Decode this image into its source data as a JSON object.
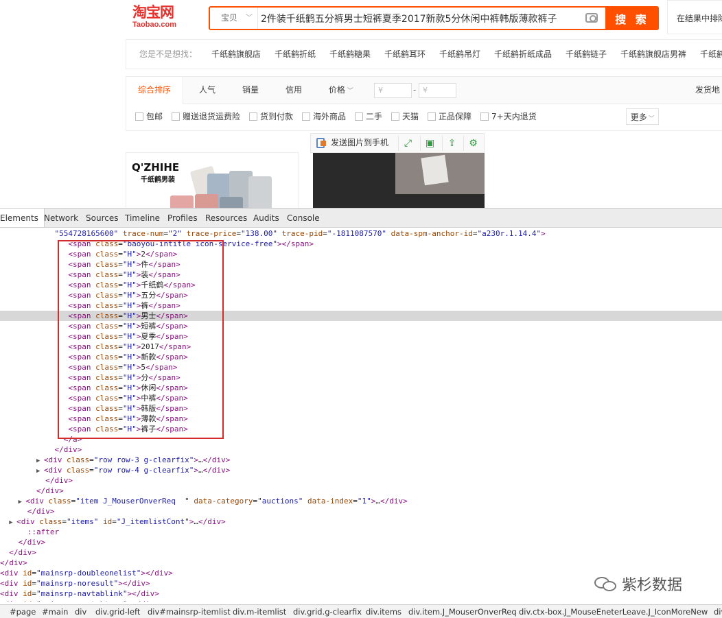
{
  "taobao": {
    "logo_cn": "淘宝网",
    "logo_en": "Taobao.com",
    "search_category": "宝贝",
    "search_value": "2件装千纸鹤五分裤男士短裤夏季2017新款5分休闲中裤韩版薄款裤子",
    "search_button": "搜 索",
    "search_in_results": "在结果中排除",
    "suggest_label": "您是不是想找：",
    "suggestions": [
      "千纸鹤旗舰店",
      "千纸鹤折纸",
      "千纸鹤糖果",
      "千纸鹤耳环",
      "千纸鹤吊灯",
      "千纸鹤折纸成品",
      "千纸鹤链子",
      "千纸鹤旗舰店男裤",
      "千纸鹤"
    ],
    "sort_tabs": [
      "综合排序",
      "人气",
      "销量",
      "信用",
      "价格"
    ],
    "price_from_placeholder": "¥",
    "price_to_placeholder": "¥",
    "price_dash": "-",
    "ship_from": "发货地",
    "filters": [
      "包邮",
      "赠送退货运费险",
      "货到付款",
      "海外商品",
      "二手",
      "天猫",
      "正品保障",
      "7+天内退货"
    ],
    "more": "更多",
    "send_to_phone": "发送图片到手机",
    "brand_name": "Q'ZHIHE",
    "brand_sub": "千纸鹤男装"
  },
  "devtools": {
    "tabs": [
      "Elements",
      "Network",
      "Sources",
      "Timeline",
      "Profiles",
      "Resources",
      "Audits",
      "Console"
    ],
    "top_line": {
      "indent": "            ",
      "parts": [
        {
          "t": "val",
          "s": "\"554728165600\""
        },
        {
          "t": "txt",
          "s": " "
        },
        {
          "t": "attr",
          "s": "trace-num"
        },
        {
          "t": "txt",
          "s": "="
        },
        {
          "t": "val",
          "s": "\"2\""
        },
        {
          "t": "txt",
          "s": " "
        },
        {
          "t": "attr",
          "s": "trace-price"
        },
        {
          "t": "txt",
          "s": "="
        },
        {
          "t": "val",
          "s": "\"138.00\""
        },
        {
          "t": "txt",
          "s": " "
        },
        {
          "t": "attr",
          "s": "trace-pid"
        },
        {
          "t": "txt",
          "s": "="
        },
        {
          "t": "val",
          "s": "\"-1811087570\""
        },
        {
          "t": "txt",
          "s": " "
        },
        {
          "t": "attr",
          "s": "data-spm-anchor-id"
        },
        {
          "t": "txt",
          "s": "="
        },
        {
          "t": "val",
          "s": "\"a230r.1.14.4\""
        },
        {
          "t": "tag",
          "s": ">"
        }
      ]
    },
    "span_first": {
      "class": "baoyou-intitle icon-service-free",
      "text": ""
    },
    "spans": [
      {
        "class": "H",
        "text": "2"
      },
      {
        "class": "H",
        "text": "件"
      },
      {
        "class": "H",
        "text": "装"
      },
      {
        "class": "H",
        "text": "千纸鹤"
      },
      {
        "class": "H",
        "text": "五分"
      },
      {
        "class": "H",
        "text": "裤"
      },
      {
        "class": "H",
        "text": "男士",
        "selected": true
      },
      {
        "class": "H",
        "text": "短裤"
      },
      {
        "class": "H",
        "text": "夏季"
      },
      {
        "class": "H",
        "text": "2017"
      },
      {
        "class": "H",
        "text": "新款"
      },
      {
        "class": "H",
        "text": "5"
      },
      {
        "class": "H",
        "text": "分"
      },
      {
        "class": "H",
        "text": "休闲"
      },
      {
        "class": "H",
        "text": "中裤"
      },
      {
        "class": "H",
        "text": "韩版"
      },
      {
        "class": "H",
        "text": "薄款"
      },
      {
        "class": "H",
        "text": "裤子"
      }
    ],
    "tail_lines": [
      {
        "indent": "              ",
        "tri": false,
        "raw": [
          {
            "t": "tag",
            "s": "</a>"
          }
        ]
      },
      {
        "indent": "            ",
        "tri": false,
        "raw": [
          {
            "t": "tag",
            "s": "</div>"
          }
        ]
      },
      {
        "indent": "          ",
        "tri": true,
        "raw": [
          {
            "t": "tag",
            "s": "<div "
          },
          {
            "t": "attr",
            "s": "class"
          },
          {
            "t": "txt",
            "s": "="
          },
          {
            "t": "val",
            "s": "\"row row-3 g-clearfix\""
          },
          {
            "t": "tag",
            "s": ">"
          },
          {
            "t": "txt",
            "s": "…"
          },
          {
            "t": "tag",
            "s": "</div>"
          }
        ]
      },
      {
        "indent": "          ",
        "tri": true,
        "raw": [
          {
            "t": "tag",
            "s": "<div "
          },
          {
            "t": "attr",
            "s": "class"
          },
          {
            "t": "txt",
            "s": "="
          },
          {
            "t": "val",
            "s": "\"row row-4 g-clearfix\""
          },
          {
            "t": "tag",
            "s": ">"
          },
          {
            "t": "txt",
            "s": "…"
          },
          {
            "t": "tag",
            "s": "</div>"
          }
        ]
      },
      {
        "indent": "          ",
        "tri": false,
        "raw": [
          {
            "t": "tag",
            "s": "</div>"
          }
        ]
      },
      {
        "indent": "        ",
        "tri": false,
        "raw": [
          {
            "t": "tag",
            "s": "</div>"
          }
        ]
      },
      {
        "indent": "      ",
        "tri": true,
        "raw": [
          {
            "t": "tag",
            "s": "<div "
          },
          {
            "t": "attr",
            "s": "class"
          },
          {
            "t": "txt",
            "s": "="
          },
          {
            "t": "val",
            "s": "\"item J_MouserOnverReq  \""
          },
          {
            "t": "txt",
            "s": " "
          },
          {
            "t": "attr",
            "s": "data-category"
          },
          {
            "t": "txt",
            "s": "="
          },
          {
            "t": "val",
            "s": "\"auctions\""
          },
          {
            "t": "txt",
            "s": " "
          },
          {
            "t": "attr",
            "s": "data-index"
          },
          {
            "t": "txt",
            "s": "="
          },
          {
            "t": "val",
            "s": "\"1\""
          },
          {
            "t": "tag",
            "s": ">"
          },
          {
            "t": "txt",
            "s": "…"
          },
          {
            "t": "tag",
            "s": "</div>"
          }
        ]
      },
      {
        "indent": "      ",
        "tri": false,
        "raw": [
          {
            "t": "tag",
            "s": "</div>"
          }
        ]
      },
      {
        "indent": "    ",
        "tri": true,
        "raw": [
          {
            "t": "tag",
            "s": "<div "
          },
          {
            "t": "attr",
            "s": "class"
          },
          {
            "t": "txt",
            "s": "="
          },
          {
            "t": "val",
            "s": "\"items\""
          },
          {
            "t": "txt",
            "s": " "
          },
          {
            "t": "attr",
            "s": "id"
          },
          {
            "t": "txt",
            "s": "="
          },
          {
            "t": "val",
            "s": "\"J_itemlistCont\""
          },
          {
            "t": "tag",
            "s": ">"
          },
          {
            "t": "txt",
            "s": "…"
          },
          {
            "t": "tag",
            "s": "</div>"
          }
        ]
      },
      {
        "indent": "      ",
        "tri": false,
        "raw": [
          {
            "t": "pseudo",
            "s": "::after"
          }
        ]
      },
      {
        "indent": "    ",
        "tri": false,
        "raw": [
          {
            "t": "tag",
            "s": "</div>"
          }
        ]
      },
      {
        "indent": "  ",
        "tri": false,
        "raw": [
          {
            "t": "tag",
            "s": "</div>"
          }
        ]
      },
      {
        "indent": "",
        "tri": false,
        "raw": [
          {
            "t": "tag",
            "s": "</div>"
          }
        ]
      },
      {
        "indent": "",
        "tri": false,
        "raw": [
          {
            "t": "tag",
            "s": "<div "
          },
          {
            "t": "attr",
            "s": "id"
          },
          {
            "t": "txt",
            "s": "="
          },
          {
            "t": "val",
            "s": "\"mainsrp-doubleonelist\""
          },
          {
            "t": "tag",
            "s": ">"
          },
          {
            "t": "tag",
            "s": "</div>"
          }
        ]
      },
      {
        "indent": "",
        "tri": false,
        "raw": [
          {
            "t": "tag",
            "s": "<div "
          },
          {
            "t": "attr",
            "s": "id"
          },
          {
            "t": "txt",
            "s": "="
          },
          {
            "t": "val",
            "s": "\"mainsrp-noresult\""
          },
          {
            "t": "tag",
            "s": ">"
          },
          {
            "t": "tag",
            "s": "</div>"
          }
        ]
      },
      {
        "indent": "",
        "tri": false,
        "raw": [
          {
            "t": "tag",
            "s": "<div "
          },
          {
            "t": "attr",
            "s": "id"
          },
          {
            "t": "txt",
            "s": "="
          },
          {
            "t": "val",
            "s": "\"mainsrp-navtablink\""
          },
          {
            "t": "tag",
            "s": ">"
          },
          {
            "t": "tag",
            "s": "</div>"
          }
        ]
      },
      {
        "indent": "",
        "tri": false,
        "raw": [
          {
            "t": "tag",
            "s": "<div "
          },
          {
            "t": "attr",
            "s": "id"
          },
          {
            "t": "txt",
            "s": "="
          },
          {
            "t": "val",
            "s": "\"mainsrp-navtabtags\""
          },
          {
            "t": "tag",
            "s": ">"
          },
          {
            "t": "tag",
            "s": "</div>"
          }
        ]
      }
    ],
    "breadcrumbs": [
      "#page",
      "#main",
      "div",
      "div.grid-left",
      "div#mainsrp-itemlist",
      "div.m-itemlist",
      "div.grid.g-clearfix",
      "div.items",
      "div.item.J_MouserOnverReq",
      "div.ctx-box.J_MouseEneterLeave.J_IconMoreNew",
      "div.ro"
    ]
  },
  "watermark": "紫杉数据",
  "colors": {
    "accent": "#ff5000",
    "logo": "#e4322e",
    "highlight_box": "#d42a2a",
    "tag": "#881280",
    "attr": "#994500",
    "value": "#1a1aa6"
  }
}
